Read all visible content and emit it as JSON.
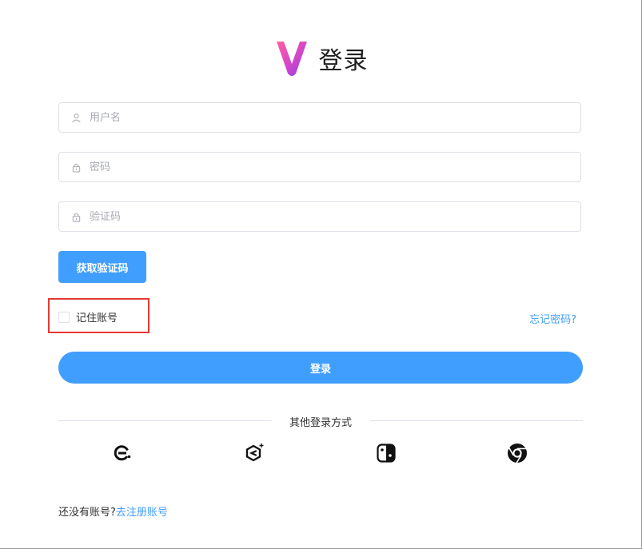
{
  "header": {
    "title": "登录",
    "logo_icon": "v-logo-icon"
  },
  "form": {
    "username_placeholder": "用户名",
    "password_placeholder": "密码",
    "captcha_placeholder": "验证码",
    "username_value": "",
    "password_value": "",
    "captcha_value": "",
    "get_code_label": "获取验证码",
    "remember_label": "记住账号",
    "remember_checked": false,
    "forgot_label": "忘记密码?",
    "login_label": "登录"
  },
  "other_login": {
    "label": "其他登录方式",
    "providers": [
      "e-brand-icon",
      "hexagon-plus-icon",
      "nintendo-switch-icon",
      "chrome-icon"
    ]
  },
  "register": {
    "prompt": "还没有账号?",
    "link": "去注册账号"
  },
  "colors": {
    "primary": "#409eff",
    "border": "#dcdfe6",
    "highlight": "#e53935"
  }
}
